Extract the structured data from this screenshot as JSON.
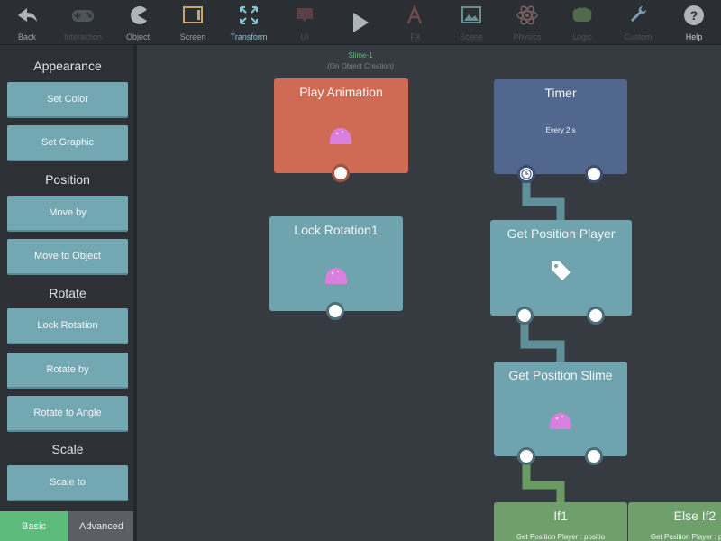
{
  "toolbar": {
    "back": "Back",
    "interaction": "Interaction",
    "object": "Object",
    "screen": "Screen",
    "transform": "Transform",
    "ui": "UI",
    "fx": "FX",
    "scene": "Scene",
    "physics": "Physics",
    "logic": "Logic",
    "custom": "Custom",
    "help": "Help"
  },
  "sidebar": {
    "appearance": "Appearance",
    "set_color": "Set Color",
    "set_graphic": "Set Graphic",
    "position": "Position",
    "move_by": "Move by",
    "move_to_object": "Move to Object",
    "rotate": "Rotate",
    "lock_rotation": "Lock Rotation",
    "rotate_by": "Rotate by",
    "rotate_to_angle": "Rotate to Angle",
    "scale": "Scale",
    "scale_to": "Scale to"
  },
  "tabs": {
    "basic": "Basic",
    "advanced": "Advanced"
  },
  "canvas": {
    "object_name": "Slime-1",
    "object_event": "(On Object Creation)",
    "nodes": {
      "play_animation": "Play Animation",
      "timer": "Timer",
      "timer_sub": "Every 2 s",
      "lock_rotation": "Lock Rotation1",
      "get_position_player": "Get Position Player",
      "get_position_slime": "Get Position Slime",
      "if1": "If1",
      "if1_sub": "Get Position Player : positio",
      "else_if2": "Else If2",
      "else_if2_sub": "Get Position Player : positio"
    }
  },
  "colors": {
    "orange_node": "#cf6a55",
    "blue_node": "#51678e",
    "teal_node": "#6fa3ad",
    "green_node": "#6fa06b",
    "slime": "#d97fdd",
    "basic_tab": "#5dbb7c",
    "advanced_tab": "#5b5f64"
  }
}
